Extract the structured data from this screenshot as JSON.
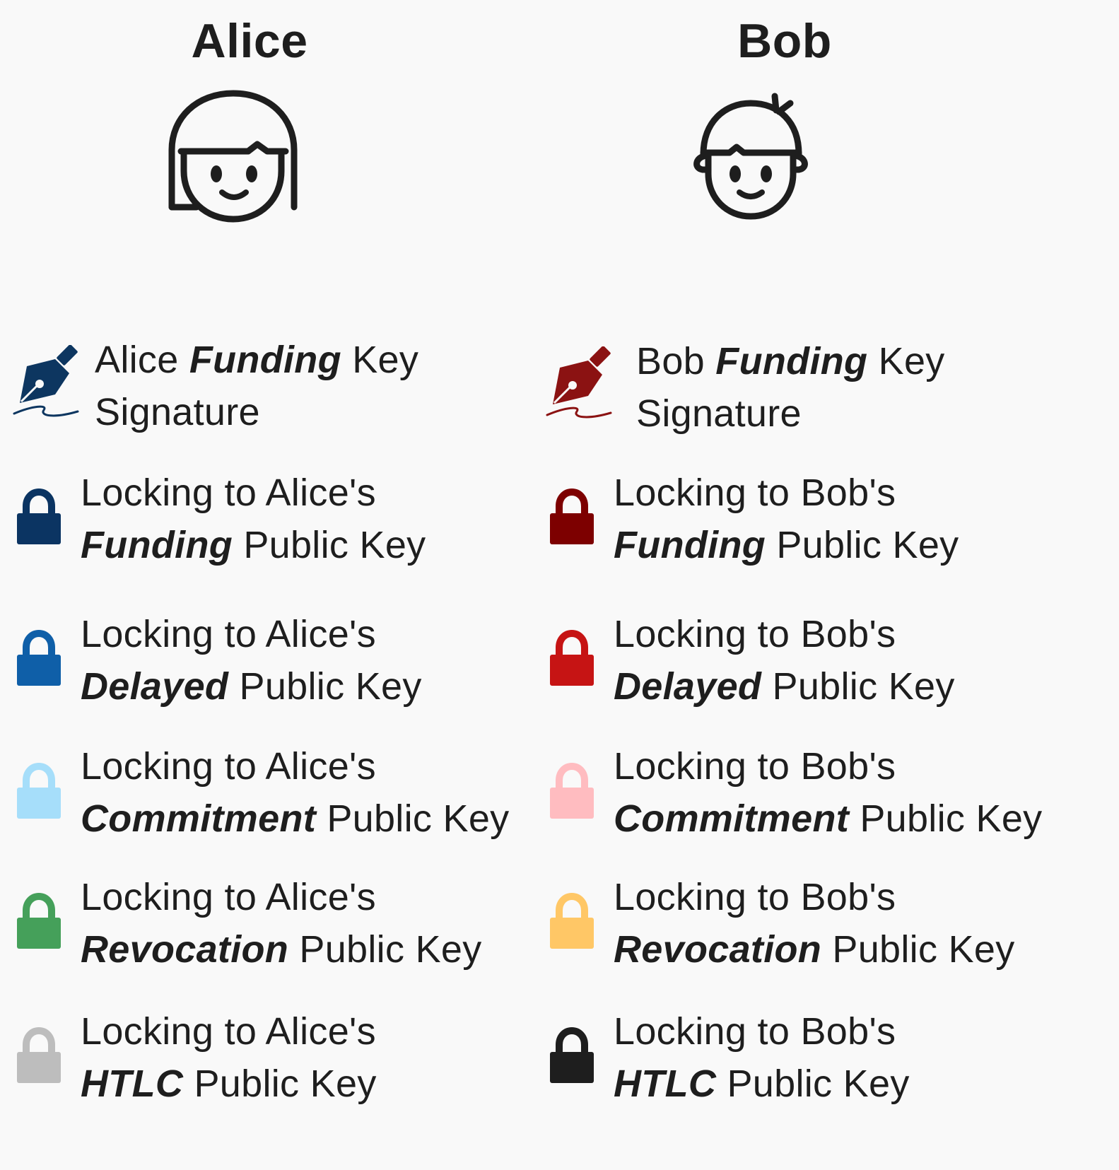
{
  "parties": {
    "alice": {
      "name": "Alice",
      "icon": "girl-avatar-icon"
    },
    "bob": {
      "name": "Bob",
      "icon": "boy-avatar-icon"
    }
  },
  "alice": {
    "signature": {
      "icon": "pen-nib-signature-icon",
      "color": "#0d3660",
      "pre": "Alice",
      "keyword": "Funding",
      "post": "Key",
      "line2": "Signature"
    },
    "locks": [
      {
        "icon": "lock-icon",
        "color": "#0b3462",
        "line1": "Locking to Alice's",
        "keyword": "Funding",
        "post": "Public Key"
      },
      {
        "icon": "lock-icon",
        "color": "#0f5fa8",
        "line1": "Locking to Alice's",
        "keyword": "Delayed",
        "post": "Public Key"
      },
      {
        "icon": "lock-icon",
        "color": "#a6defa",
        "line1": "Locking to Alice's",
        "keyword": "Commitment",
        "post": "Public Key"
      },
      {
        "icon": "lock-icon",
        "color": "#45a05a",
        "line1": "Locking to Alice's",
        "keyword": "Revocation",
        "post": "Public Key"
      },
      {
        "icon": "lock-icon",
        "color": "#bdbdbd",
        "line1": "Locking to Alice's",
        "keyword": "HTLC",
        "post": "Public Key"
      }
    ]
  },
  "bob": {
    "signature": {
      "icon": "pen-nib-signature-icon",
      "color": "#8b1212",
      "pre": "Bob",
      "keyword": "Funding",
      "post": "Key",
      "line2": "Signature"
    },
    "locks": [
      {
        "icon": "lock-icon",
        "color": "#7d0000",
        "line1": "Locking to Bob's",
        "keyword": "Funding",
        "post": "Public Key"
      },
      {
        "icon": "lock-icon",
        "color": "#c61414",
        "line1": "Locking to Bob's",
        "keyword": "Delayed",
        "post": "Public Key"
      },
      {
        "icon": "lock-icon",
        "color": "#ffbcc0",
        "line1": "Locking to Bob's",
        "keyword": "Commitment",
        "post": "Public Key"
      },
      {
        "icon": "lock-icon",
        "color": "#ffc766",
        "line1": "Locking to Bob's",
        "keyword": "Revocation",
        "post": "Public Key"
      },
      {
        "icon": "lock-icon",
        "color": "#1e1e1e",
        "line1": "Locking to Bob's",
        "keyword": "HTLC",
        "post": "Public Key"
      }
    ]
  }
}
